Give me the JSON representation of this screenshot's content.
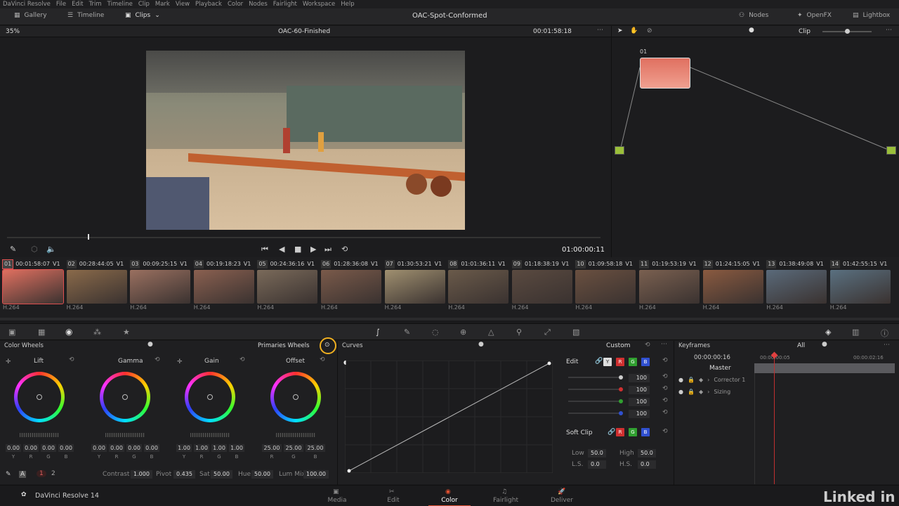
{
  "menu": [
    "DaVinci Resolve",
    "File",
    "Edit",
    "Trim",
    "Timeline",
    "Clip",
    "Mark",
    "View",
    "Playback",
    "Color",
    "Nodes",
    "Fairlight",
    "Workspace",
    "Help"
  ],
  "topbar": {
    "gallery": "Gallery",
    "timeline": "Timeline",
    "clips": "Clips",
    "project": "OAC-Spot-Conformed",
    "nodes": "Nodes",
    "openfx": "OpenFX",
    "lightbox": "Lightbox"
  },
  "viewer": {
    "zoom": "35%",
    "clip_name": "OAC-60-Finished",
    "timecode": "00:01:58:18",
    "playhead_tc": "01:00:00:11"
  },
  "nodebar": {
    "mode": "Clip"
  },
  "node": {
    "label": "01"
  },
  "clips": [
    {
      "num": "01",
      "tc": "00:01:58:07",
      "track": "V1",
      "codec": "H.264",
      "color": "#e07060"
    },
    {
      "num": "02",
      "tc": "00:28:44:05",
      "track": "V1",
      "codec": "H.264",
      "color": "#8a6a4a"
    },
    {
      "num": "03",
      "tc": "00:09:25:15",
      "track": "V1",
      "codec": "H.264",
      "color": "#9a7060"
    },
    {
      "num": "04",
      "tc": "00:19:18:23",
      "track": "V1",
      "codec": "H.264",
      "color": "#8a6050"
    },
    {
      "num": "05",
      "tc": "00:24:36:16",
      "track": "V1",
      "codec": "H.264",
      "color": "#7a6a5a"
    },
    {
      "num": "06",
      "tc": "01:28:36:08",
      "track": "V1",
      "codec": "H.264",
      "color": "#7a5a4a"
    },
    {
      "num": "07",
      "tc": "01:30:53:21",
      "track": "V1",
      "codec": "H.264",
      "color": "#a09070"
    },
    {
      "num": "08",
      "tc": "01:01:36:11",
      "track": "V1",
      "codec": "H.264",
      "color": "#6a5a4a"
    },
    {
      "num": "09",
      "tc": "01:18:38:19",
      "track": "V1",
      "codec": "H.264",
      "color": "#5a4a40"
    },
    {
      "num": "10",
      "tc": "01:09:58:18",
      "track": "V1",
      "codec": "H.264",
      "color": "#6a5040"
    },
    {
      "num": "11",
      "tc": "01:19:53:19",
      "track": "V1",
      "codec": "H.264",
      "color": "#7a6050"
    },
    {
      "num": "12",
      "tc": "01:24:15:05",
      "track": "V1",
      "codec": "H.264",
      "color": "#8a5a40"
    },
    {
      "num": "13",
      "tc": "01:38:49:08",
      "track": "V1",
      "codec": "H.264",
      "color": "#5a6a7a"
    },
    {
      "num": "14",
      "tc": "01:42:55:15",
      "track": "V1",
      "codec": "H.264",
      "color": "#5a7080"
    }
  ],
  "color_wheels": {
    "title": "Color Wheels",
    "mode": "Primaries Wheels",
    "wheels": [
      {
        "name": "Lift",
        "values": [
          "0.00",
          "0.00",
          "0.00",
          "0.00"
        ]
      },
      {
        "name": "Gamma",
        "values": [
          "0.00",
          "0.00",
          "0.00",
          "0.00"
        ]
      },
      {
        "name": "Gain",
        "values": [
          "1.00",
          "1.00",
          "1.00",
          "1.00"
        ]
      },
      {
        "name": "Offset",
        "values": [
          "25.00",
          "25.00",
          "25.00"
        ]
      }
    ],
    "channels": [
      "Y",
      "R",
      "G",
      "B"
    ],
    "offset_channels": [
      "R",
      "G",
      "B"
    ],
    "contrast_label": "Contrast",
    "contrast": "1.000",
    "pivot_label": "Pivot",
    "pivot": "0.435",
    "sat_label": "Sat",
    "sat": "50.00",
    "hue_label": "Hue",
    "hue": "50.00",
    "lummix_label": "Lum Mix",
    "lummix": "100.00",
    "page1": "1",
    "page2": "2"
  },
  "curves": {
    "title": "Curves",
    "mode": "Custom",
    "edit_label": "Edit",
    "edit_values": [
      "100",
      "100",
      "100",
      "100"
    ],
    "softclip_label": "Soft Clip",
    "low_label": "Low",
    "low": "50.0",
    "high_label": "High",
    "high": "50.0",
    "ls_label": "L.S.",
    "ls": "0.0",
    "hs_label": "H.S.",
    "hs": "0.0"
  },
  "keyframes": {
    "title": "Keyframes",
    "filter": "All",
    "timecode": "00:00:00:16",
    "tc_start": "00:00:00:05",
    "tc_end": "00:00:02:16",
    "master": "Master",
    "tracks": [
      "Corrector 1",
      "Sizing"
    ]
  },
  "footer": {
    "app": "DaVinci Resolve 14",
    "tabs": [
      "Media",
      "Edit",
      "Color",
      "Fairlight",
      "Deliver"
    ],
    "active": "Color",
    "watermark": "Linked in"
  }
}
